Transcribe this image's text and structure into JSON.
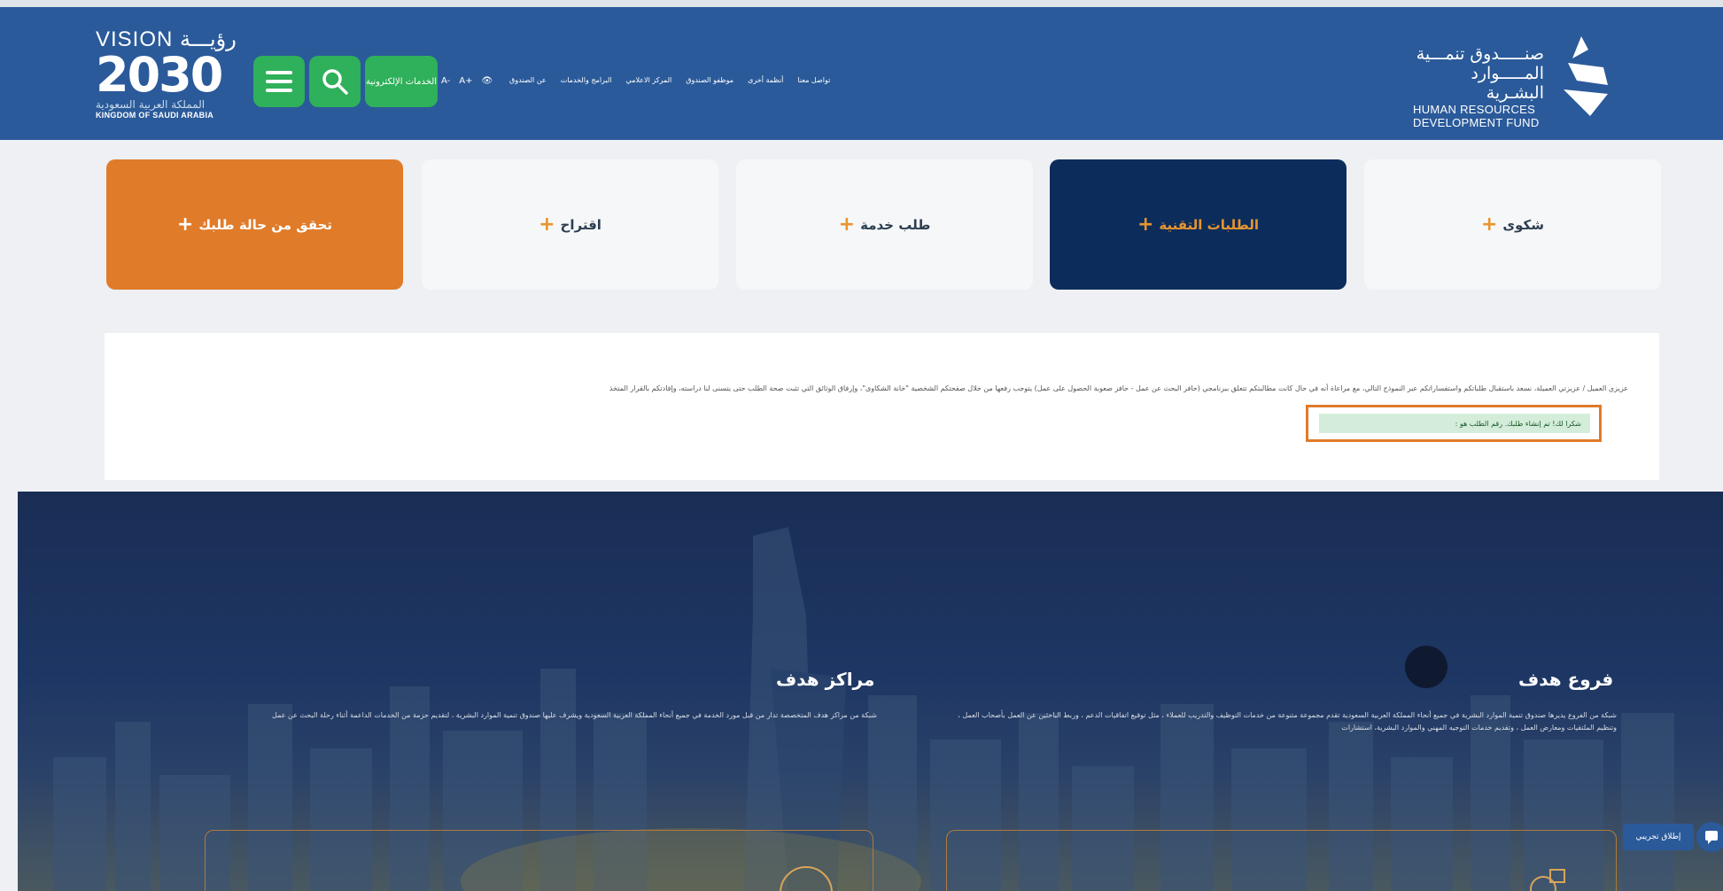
{
  "header": {
    "brand_ar": "صنـــــدوق تنمـــية",
    "brand_ar2": "المـــــوارد البشـرية",
    "brand_en1": "HUMAN RESOURCES",
    "brand_en2": "DEVELOPMENT FUND",
    "vision_top": "VISION رؤيـــة",
    "vision_year": "2030",
    "vision_ar": "المملكة العربية السعودية",
    "vision_en": "KINGDOM OF SAUDI ARABIA",
    "eservices": "الخدمات الإلكترونية",
    "a11y": [
      "A+",
      "A-"
    ],
    "nav": [
      "عن الصندوق",
      "البرامج والخدمات",
      "المركز الاعلامي",
      "موظفو الصندوق",
      "أنظمة أخرى",
      "تواصل معنا"
    ]
  },
  "cards": {
    "complaint": "شكوى",
    "tech": "الطلبات التقنية",
    "service": "طلب خدمة",
    "suggest": "اقتراح",
    "check": "تحقق من حالة طلبك"
  },
  "notice": {
    "text": "عزيزي العميل / عزيزتي العميلة، نسعد باستقبال طلباتكم واستفساراتكم عبر النموذج التالي، مع مراعاة أنه في حال كانت مطالبتكم تتعلق ببرنامجي (حافز البحث عن عمل - حافز صعوبة الحصول على عمل) يتوجب رفعها من خلال صفحتكم الشخصية \"خانة الشكاوى\"، وإرفاق الوثائق التي تثبت صحة الطلب حتى يتسنى لنا دراسته، وإفادتكم بالقرار المتخذ",
    "success": "شكرا لك! تم إنشاء طلبك. رقم الطلب هو :"
  },
  "footer": {
    "branches_title": "فروع هدف",
    "branches_desc": "شبكة من الفروع يديرها صندوق تنمية الموارد البشرية في جميع أنحاء المملكة العربية السعودية تقدم مجموعة متنوعة من خدمات التوظيف والتدريب للعملاء ، مثل توقيع اتفاقيات الدعم ، وربط الباحثين عن العمل بأصحاب العمل ، وتنظيم الملتقيات ومعارض العمل ، وتقديم خدمات التوجيه المهني والموارد البشرية، استشارات",
    "centers_title": "مراكز هدف",
    "centers_desc": "شبكة من مراكز هدف المتخصصة تدار من قبل مورد الخدمة في جميع أنحاء المملكة العربية السعودية ويشرف عليها صندوق تنمية الموارد البشرية ، لتقديم حزمة من الخدمات الداعمة أثناء رحلة البحث عن عمل",
    "trial": "إطلاق تجريبي"
  },
  "colors": {
    "header": "#2a5a9a",
    "green": "#2fb05a",
    "orange": "#e07b2a",
    "navy": "#0c2d5c"
  }
}
